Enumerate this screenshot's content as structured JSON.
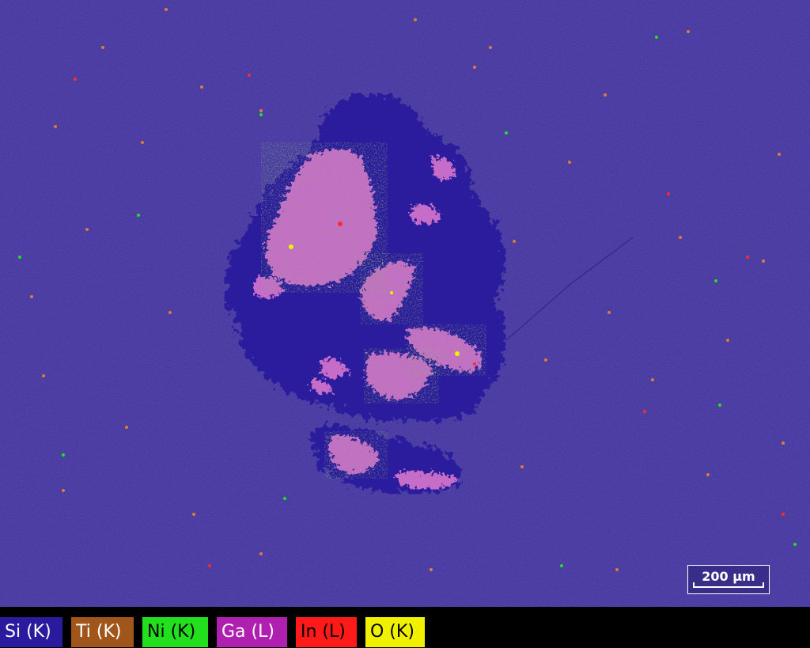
{
  "image": {
    "scale_bar_label": "200 µm",
    "background_color": "#3a2a9a"
  },
  "legend": [
    {
      "label": "Si (K)",
      "color": "#2a1a9e",
      "text_color": "#ffffff"
    },
    {
      "label": "Ti (K)",
      "color": "#a0561a",
      "text_color": "#ffffff"
    },
    {
      "label": "Ni (K)",
      "color": "#22e01e",
      "text_color": "#000000"
    },
    {
      "label": "Ga (L)",
      "color": "#b020b0",
      "text_color": "#ffffff"
    },
    {
      "label": "In (L)",
      "color": "#ff1a1a",
      "text_color": "#000000"
    },
    {
      "label": "O (K)",
      "color": "#f0f000",
      "text_color": "#000000"
    }
  ]
}
